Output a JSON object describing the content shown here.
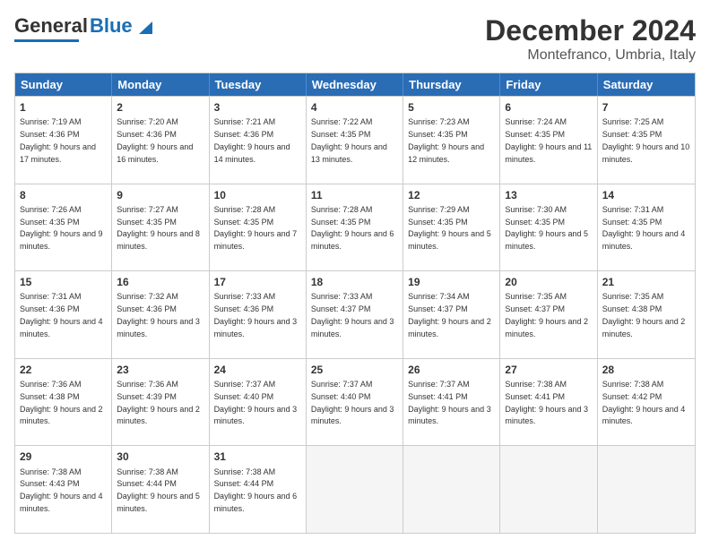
{
  "logo": {
    "part1": "General",
    "part2": "Blue"
  },
  "title": "December 2024",
  "subtitle": "Montefranco, Umbria, Italy",
  "days": [
    "Sunday",
    "Monday",
    "Tuesday",
    "Wednesday",
    "Thursday",
    "Friday",
    "Saturday"
  ],
  "weeks": [
    [
      {
        "num": "1",
        "rise": "7:19 AM",
        "set": "4:36 PM",
        "daylight": "9 hours and 17 minutes."
      },
      {
        "num": "2",
        "rise": "7:20 AM",
        "set": "4:36 PM",
        "daylight": "9 hours and 16 minutes."
      },
      {
        "num": "3",
        "rise": "7:21 AM",
        "set": "4:36 PM",
        "daylight": "9 hours and 14 minutes."
      },
      {
        "num": "4",
        "rise": "7:22 AM",
        "set": "4:35 PM",
        "daylight": "9 hours and 13 minutes."
      },
      {
        "num": "5",
        "rise": "7:23 AM",
        "set": "4:35 PM",
        "daylight": "9 hours and 12 minutes."
      },
      {
        "num": "6",
        "rise": "7:24 AM",
        "set": "4:35 PM",
        "daylight": "9 hours and 11 minutes."
      },
      {
        "num": "7",
        "rise": "7:25 AM",
        "set": "4:35 PM",
        "daylight": "9 hours and 10 minutes."
      }
    ],
    [
      {
        "num": "8",
        "rise": "7:26 AM",
        "set": "4:35 PM",
        "daylight": "9 hours and 9 minutes."
      },
      {
        "num": "9",
        "rise": "7:27 AM",
        "set": "4:35 PM",
        "daylight": "9 hours and 8 minutes."
      },
      {
        "num": "10",
        "rise": "7:28 AM",
        "set": "4:35 PM",
        "daylight": "9 hours and 7 minutes."
      },
      {
        "num": "11",
        "rise": "7:28 AM",
        "set": "4:35 PM",
        "daylight": "9 hours and 6 minutes."
      },
      {
        "num": "12",
        "rise": "7:29 AM",
        "set": "4:35 PM",
        "daylight": "9 hours and 5 minutes."
      },
      {
        "num": "13",
        "rise": "7:30 AM",
        "set": "4:35 PM",
        "daylight": "9 hours and 5 minutes."
      },
      {
        "num": "14",
        "rise": "7:31 AM",
        "set": "4:35 PM",
        "daylight": "9 hours and 4 minutes."
      }
    ],
    [
      {
        "num": "15",
        "rise": "7:31 AM",
        "set": "4:36 PM",
        "daylight": "9 hours and 4 minutes."
      },
      {
        "num": "16",
        "rise": "7:32 AM",
        "set": "4:36 PM",
        "daylight": "9 hours and 3 minutes."
      },
      {
        "num": "17",
        "rise": "7:33 AM",
        "set": "4:36 PM",
        "daylight": "9 hours and 3 minutes."
      },
      {
        "num": "18",
        "rise": "7:33 AM",
        "set": "4:37 PM",
        "daylight": "9 hours and 3 minutes."
      },
      {
        "num": "19",
        "rise": "7:34 AM",
        "set": "4:37 PM",
        "daylight": "9 hours and 2 minutes."
      },
      {
        "num": "20",
        "rise": "7:35 AM",
        "set": "4:37 PM",
        "daylight": "9 hours and 2 minutes."
      },
      {
        "num": "21",
        "rise": "7:35 AM",
        "set": "4:38 PM",
        "daylight": "9 hours and 2 minutes."
      }
    ],
    [
      {
        "num": "22",
        "rise": "7:36 AM",
        "set": "4:38 PM",
        "daylight": "9 hours and 2 minutes."
      },
      {
        "num": "23",
        "rise": "7:36 AM",
        "set": "4:39 PM",
        "daylight": "9 hours and 2 minutes."
      },
      {
        "num": "24",
        "rise": "7:37 AM",
        "set": "4:40 PM",
        "daylight": "9 hours and 3 minutes."
      },
      {
        "num": "25",
        "rise": "7:37 AM",
        "set": "4:40 PM",
        "daylight": "9 hours and 3 minutes."
      },
      {
        "num": "26",
        "rise": "7:37 AM",
        "set": "4:41 PM",
        "daylight": "9 hours and 3 minutes."
      },
      {
        "num": "27",
        "rise": "7:38 AM",
        "set": "4:41 PM",
        "daylight": "9 hours and 3 minutes."
      },
      {
        "num": "28",
        "rise": "7:38 AM",
        "set": "4:42 PM",
        "daylight": "9 hours and 4 minutes."
      }
    ],
    [
      {
        "num": "29",
        "rise": "7:38 AM",
        "set": "4:43 PM",
        "daylight": "9 hours and 4 minutes."
      },
      {
        "num": "30",
        "rise": "7:38 AM",
        "set": "4:44 PM",
        "daylight": "9 hours and 5 minutes."
      },
      {
        "num": "31",
        "rise": "7:38 AM",
        "set": "4:44 PM",
        "daylight": "9 hours and 6 minutes."
      },
      null,
      null,
      null,
      null
    ]
  ]
}
